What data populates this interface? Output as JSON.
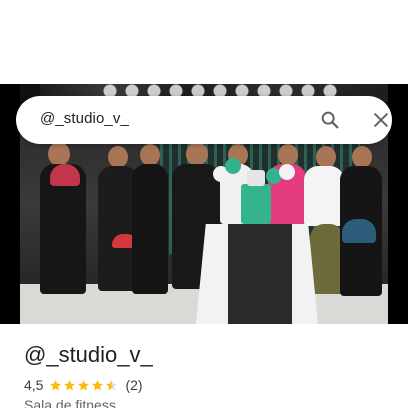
{
  "search": {
    "query": "@_studio_v_"
  },
  "icons": {
    "search": "search-icon",
    "close": "close-icon",
    "star": "star-icon"
  },
  "place": {
    "name": "@_studio_v_",
    "rating": "4,5",
    "rating_value": 4.5,
    "rating_max": 5,
    "review_count": "(2)",
    "category": "Sala de fitness"
  },
  "colors": {
    "star": "#fbbc04",
    "star_empty": "#dadce0",
    "text_primary": "#202124",
    "icon": "#5f6368"
  }
}
